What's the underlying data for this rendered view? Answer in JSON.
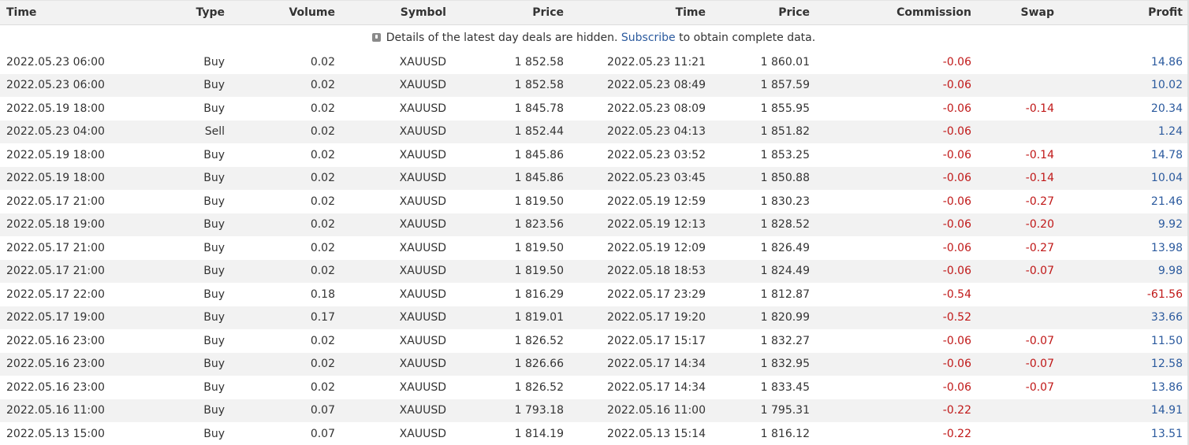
{
  "headers": [
    "Time",
    "Type",
    "Volume",
    "Symbol",
    "Price",
    "Time",
    "Price",
    "Commission",
    "Swap",
    "Profit"
  ],
  "notice": {
    "text_before": "Details of the latest day deals are hidden.",
    "link": "Subscribe",
    "text_after": "to obtain complete data."
  },
  "colors": {
    "negative": "#c01818",
    "positive": "#2b5a9e",
    "row_alt": "#f2f2f2"
  },
  "rows": [
    {
      "open_time": "2022.05.23 06:00",
      "type": "Buy",
      "volume": "0.02",
      "symbol": "XAUUSD",
      "open_price": "1 852.58",
      "close_time": "2022.05.23 11:21",
      "close_price": "1 860.01",
      "commission": "-0.06",
      "swap": "",
      "profit": "14.86"
    },
    {
      "open_time": "2022.05.23 06:00",
      "type": "Buy",
      "volume": "0.02",
      "symbol": "XAUUSD",
      "open_price": "1 852.58",
      "close_time": "2022.05.23 08:49",
      "close_price": "1 857.59",
      "commission": "-0.06",
      "swap": "",
      "profit": "10.02"
    },
    {
      "open_time": "2022.05.19 18:00",
      "type": "Buy",
      "volume": "0.02",
      "symbol": "XAUUSD",
      "open_price": "1 845.78",
      "close_time": "2022.05.23 08:09",
      "close_price": "1 855.95",
      "commission": "-0.06",
      "swap": "-0.14",
      "profit": "20.34"
    },
    {
      "open_time": "2022.05.23 04:00",
      "type": "Sell",
      "volume": "0.02",
      "symbol": "XAUUSD",
      "open_price": "1 852.44",
      "close_time": "2022.05.23 04:13",
      "close_price": "1 851.82",
      "commission": "-0.06",
      "swap": "",
      "profit": "1.24"
    },
    {
      "open_time": "2022.05.19 18:00",
      "type": "Buy",
      "volume": "0.02",
      "symbol": "XAUUSD",
      "open_price": "1 845.86",
      "close_time": "2022.05.23 03:52",
      "close_price": "1 853.25",
      "commission": "-0.06",
      "swap": "-0.14",
      "profit": "14.78"
    },
    {
      "open_time": "2022.05.19 18:00",
      "type": "Buy",
      "volume": "0.02",
      "symbol": "XAUUSD",
      "open_price": "1 845.86",
      "close_time": "2022.05.23 03:45",
      "close_price": "1 850.88",
      "commission": "-0.06",
      "swap": "-0.14",
      "profit": "10.04"
    },
    {
      "open_time": "2022.05.17 21:00",
      "type": "Buy",
      "volume": "0.02",
      "symbol": "XAUUSD",
      "open_price": "1 819.50",
      "close_time": "2022.05.19 12:59",
      "close_price": "1 830.23",
      "commission": "-0.06",
      "swap": "-0.27",
      "profit": "21.46"
    },
    {
      "open_time": "2022.05.18 19:00",
      "type": "Buy",
      "volume": "0.02",
      "symbol": "XAUUSD",
      "open_price": "1 823.56",
      "close_time": "2022.05.19 12:13",
      "close_price": "1 828.52",
      "commission": "-0.06",
      "swap": "-0.20",
      "profit": "9.92"
    },
    {
      "open_time": "2022.05.17 21:00",
      "type": "Buy",
      "volume": "0.02",
      "symbol": "XAUUSD",
      "open_price": "1 819.50",
      "close_time": "2022.05.19 12:09",
      "close_price": "1 826.49",
      "commission": "-0.06",
      "swap": "-0.27",
      "profit": "13.98"
    },
    {
      "open_time": "2022.05.17 21:00",
      "type": "Buy",
      "volume": "0.02",
      "symbol": "XAUUSD",
      "open_price": "1 819.50",
      "close_time": "2022.05.18 18:53",
      "close_price": "1 824.49",
      "commission": "-0.06",
      "swap": "-0.07",
      "profit": "9.98"
    },
    {
      "open_time": "2022.05.17 22:00",
      "type": "Buy",
      "volume": "0.18",
      "symbol": "XAUUSD",
      "open_price": "1 816.29",
      "close_time": "2022.05.17 23:29",
      "close_price": "1 812.87",
      "commission": "-0.54",
      "swap": "",
      "profit": "-61.56"
    },
    {
      "open_time": "2022.05.17 19:00",
      "type": "Buy",
      "volume": "0.17",
      "symbol": "XAUUSD",
      "open_price": "1 819.01",
      "close_time": "2022.05.17 19:20",
      "close_price": "1 820.99",
      "commission": "-0.52",
      "swap": "",
      "profit": "33.66"
    },
    {
      "open_time": "2022.05.16 23:00",
      "type": "Buy",
      "volume": "0.02",
      "symbol": "XAUUSD",
      "open_price": "1 826.52",
      "close_time": "2022.05.17 15:17",
      "close_price": "1 832.27",
      "commission": "-0.06",
      "swap": "-0.07",
      "profit": "11.50"
    },
    {
      "open_time": "2022.05.16 23:00",
      "type": "Buy",
      "volume": "0.02",
      "symbol": "XAUUSD",
      "open_price": "1 826.66",
      "close_time": "2022.05.17 14:34",
      "close_price": "1 832.95",
      "commission": "-0.06",
      "swap": "-0.07",
      "profit": "12.58"
    },
    {
      "open_time": "2022.05.16 23:00",
      "type": "Buy",
      "volume": "0.02",
      "symbol": "XAUUSD",
      "open_price": "1 826.52",
      "close_time": "2022.05.17 14:34",
      "close_price": "1 833.45",
      "commission": "-0.06",
      "swap": "-0.07",
      "profit": "13.86"
    },
    {
      "open_time": "2022.05.16 11:00",
      "type": "Buy",
      "volume": "0.07",
      "symbol": "XAUUSD",
      "open_price": "1 793.18",
      "close_time": "2022.05.16 11:00",
      "close_price": "1 795.31",
      "commission": "-0.22",
      "swap": "",
      "profit": "14.91"
    },
    {
      "open_time": "2022.05.13 15:00",
      "type": "Buy",
      "volume": "0.07",
      "symbol": "XAUUSD",
      "open_price": "1 814.19",
      "close_time": "2022.05.13 15:14",
      "close_price": "1 816.12",
      "commission": "-0.22",
      "swap": "",
      "profit": "13.51"
    }
  ]
}
